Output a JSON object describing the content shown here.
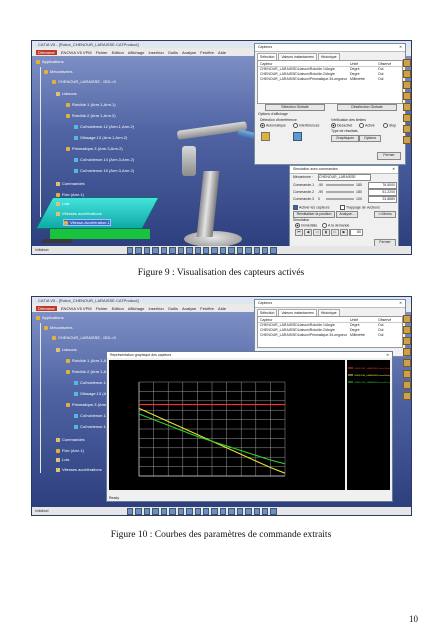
{
  "figure9": {
    "caption": "Figure 9 : Visualisation des capteurs activés",
    "window_title": "CATIA V5 - [Robot_CHENOUR_LARAISSE.CATProduct]",
    "menu": [
      "Démarrer",
      "ENOVIA V5 VPM",
      "Fichier",
      "Edition",
      "Affichage",
      "Insertion",
      "Outils",
      "Analyse",
      "Fenêtre",
      "Aide"
    ],
    "tree": {
      "applications": "Applications",
      "mecanismes": "Mécanismes",
      "mechanism": "CHENOUR_LARAISSE , DDL=0",
      "liaisons": "Liaisons",
      "rotoide1": "Rotoïde.1 (Arm.1,Arm.1)",
      "rotoide2": "Rotoïde.2 (Arm.1,Arm.2)",
      "coincidence12": "Coïncidence.12 (Arm.1,Arm.2)",
      "glissiere": "Glissage.13 (Arm.1,Arm.2)",
      "prismatique": "Prismatique.3 (Arm.3,Arm.2)",
      "coincidence14": "Coïncidence.14 (Arm.3,Arm.2)",
      "coincidence15": "Coïncidence.15 (Arm.3,Arm.2)",
      "commandes": "Commandes",
      "fixe": "Fixe (Arm.1)",
      "lois": "Lois",
      "vitesses": "Vitesses accélérations",
      "vitesse_item": "Vitesse-Accélération.1"
    },
    "capteurs": {
      "title": "Capteurs",
      "tabs": [
        "Sélection",
        "Valeurs instantanées",
        "Historique"
      ],
      "columns": [
        "Capteur",
        "Unité",
        "Observé"
      ],
      "rows": [
        [
          "CHENOUR_LARAISSE\\Liaison\\Rotoïde.1\\Angle",
          "Degré",
          "Oui"
        ],
        [
          "CHENOUR_LARAISSE\\Liaison\\Rotoïde.2\\Angle",
          "Degré",
          "Oui"
        ],
        [
          "CHENOUR_LARAISSE\\Liaison\\Prismatique.3\\Longueur",
          "Millimètre",
          "Oui"
        ]
      ],
      "btn_select_all": "Sélection Globale",
      "btn_deselect_all": "Désélection Globale",
      "affichage_title": "Options d'affichage",
      "detection_label": "Détection d'interférence",
      "limits_label": "Vérification des limites",
      "auto_label": "Automatique",
      "interf_label": "Interférences",
      "desactive_label": "Désactivé",
      "active_label": "Activé",
      "stop_label": "Stop",
      "type_label": "Type de résultats",
      "graph_btn": "Graphiques",
      "options_btn": "Options",
      "fermer_btn": "Fermer"
    },
    "simulation": {
      "title": "Simulation avec commandes",
      "tab": "CHENOUR_LARAISSE",
      "mecanisme_label": "Mécanisme :",
      "mecanisme_value": "CHENOUR_LARAISSE",
      "commands": [
        {
          "label": "Commande.1",
          "min": "-90",
          "max": "180",
          "value": "76,5000"
        },
        {
          "label": "Commande.2",
          "min": "-90",
          "max": "180",
          "value": "51,2200"
        },
        {
          "label": "Commande.3",
          "min": "0",
          "max": "100",
          "value": "23,8889"
        }
      ],
      "activer_capteurs": "Activer les capteurs",
      "trappage": "Trappage de vecteurs",
      "reinit_btn": "Réinitialiser la position",
      "analyse_btn": "Analyse...",
      "moins_btn": "<<Moins",
      "simulation_label": "Simulation",
      "immediat": "Immédiate",
      "demande": "A la demande",
      "steps": "80",
      "fermer_btn": "Fermer"
    },
    "status": "Initialiser"
  },
  "figure10": {
    "caption": "Figure 10 : Courbes des paramètres de commande extraits",
    "graph_title": "Représentation graphique des capteurs",
    "status": "Ready"
  },
  "chart_data": {
    "type": "line",
    "title": "",
    "xlabel": "",
    "ylabel": "",
    "x": [
      0,
      1,
      2,
      3,
      4,
      5,
      6,
      7,
      8,
      9,
      10
    ],
    "xlim": [
      0,
      10
    ],
    "ylim": [
      0,
      100
    ],
    "grid": true,
    "legend": "right",
    "series": [
      {
        "name": "CHENOUR_LARAISSE\\Liaison\\Rotoïde.1\\Angle",
        "color": "#ff3030",
        "values": [
          76,
          76,
          76,
          76,
          76,
          76,
          76,
          76,
          76,
          76,
          76
        ]
      },
      {
        "name": "CHENOUR_LARAISSE\\Liaison\\Rotoïde.2\\Angle",
        "color": "#e8e030",
        "values": [
          72,
          65,
          58,
          51,
          44,
          37,
          30,
          23,
          16,
          9,
          3
        ]
      },
      {
        "name": "CHENOUR_LARAISSE\\Liaison\\Prismatique.3\\Longueur",
        "color": "#30d030",
        "values": [
          66,
          60,
          54,
          48,
          42,
          37,
          32,
          27,
          22,
          17,
          13
        ]
      }
    ]
  },
  "page_number": "10"
}
